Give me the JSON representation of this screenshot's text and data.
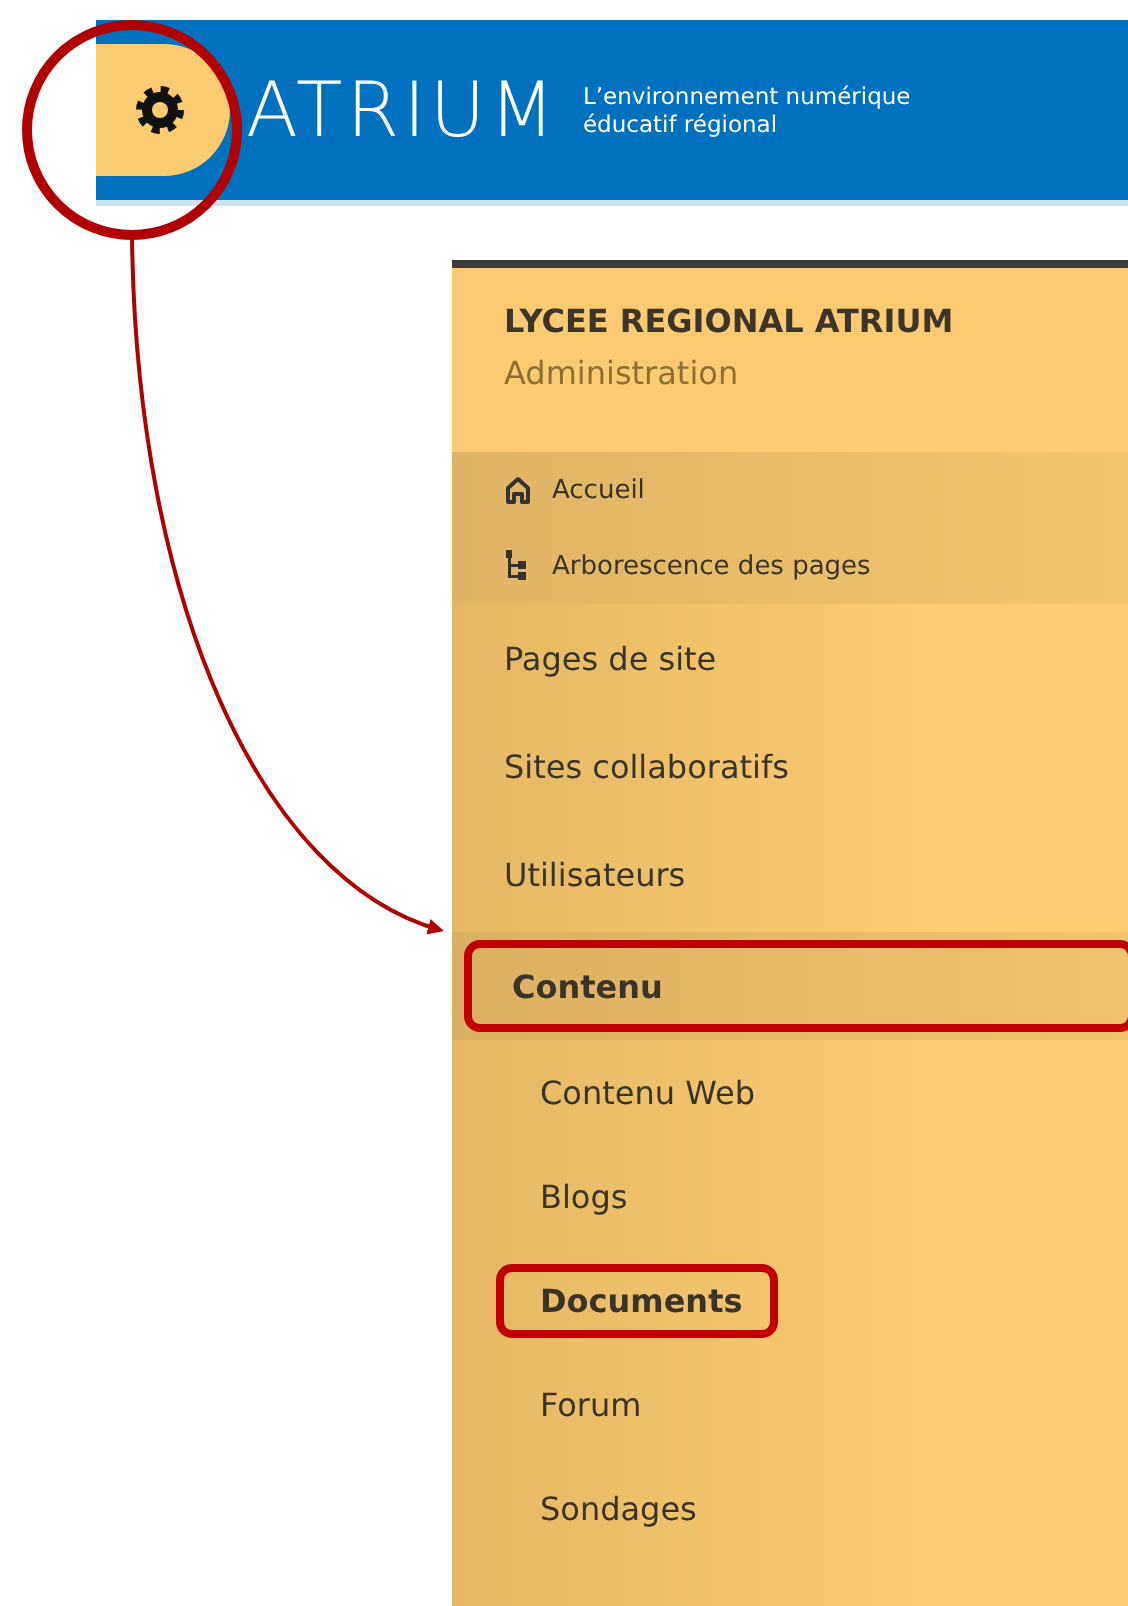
{
  "header": {
    "logo": "ATRIUM",
    "tagline": [
      "L’environnement numérique",
      "éducatif régional"
    ],
    "settings_button": {
      "annotated": true
    }
  },
  "sidebar": {
    "title": "LYCEE REGIONAL ATRIUM",
    "subtitle": "Administration",
    "quick_links": [
      {
        "label": "Accueil",
        "kind": "home"
      },
      {
        "label": "Arborescence des pages",
        "kind": "tree"
      }
    ],
    "items": [
      {
        "label": "Pages de site",
        "expanded": false,
        "annotated": false
      },
      {
        "label": "Sites collaboratifs",
        "expanded": false,
        "annotated": false
      },
      {
        "label": "Utilisateurs",
        "expanded": false,
        "annotated": false
      },
      {
        "label": "Contenu",
        "expanded": true,
        "annotated": true,
        "children": [
          {
            "label": "Contenu Web",
            "selected": false,
            "annotated": false
          },
          {
            "label": "Blogs",
            "selected": false,
            "annotated": false
          },
          {
            "label": "Documents",
            "selected": true,
            "annotated": true
          },
          {
            "label": "Forum",
            "selected": false,
            "annotated": false
          },
          {
            "label": "Sondages",
            "selected": false,
            "annotated": false
          }
        ]
      }
    ]
  }
}
